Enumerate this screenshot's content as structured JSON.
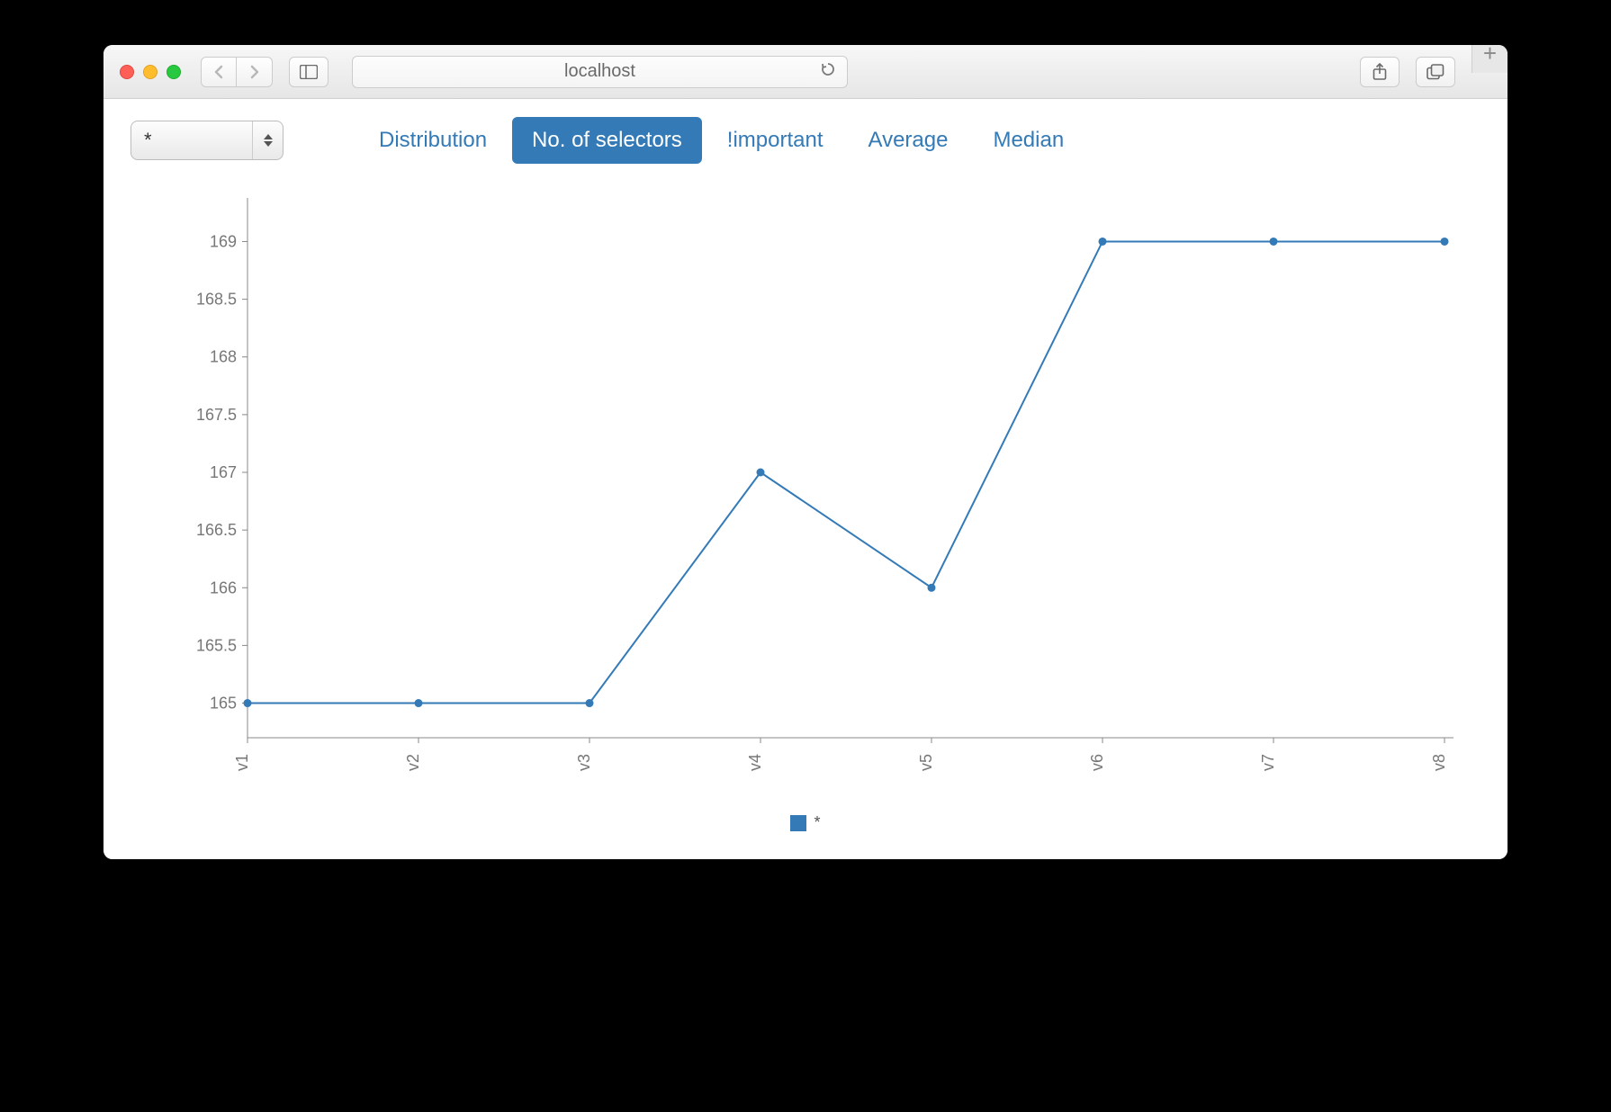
{
  "browser": {
    "address": "localhost"
  },
  "toolbar": {
    "select_value": "*",
    "tabs": [
      {
        "label": "Distribution",
        "active": false
      },
      {
        "label": "No. of selectors",
        "active": true
      },
      {
        "label": "!important",
        "active": false
      },
      {
        "label": "Average",
        "active": false
      },
      {
        "label": "Median",
        "active": false
      }
    ]
  },
  "chart_data": {
    "type": "line",
    "categories": [
      "v1",
      "v2",
      "v3",
      "v4",
      "v5",
      "v6",
      "v7",
      "v8"
    ],
    "series": [
      {
        "name": "*",
        "values": [
          165,
          165,
          165,
          167,
          166,
          169,
          169,
          169
        ]
      }
    ],
    "y_ticks": [
      165,
      165.5,
      166,
      166.5,
      167,
      167.5,
      168,
      168.5,
      169
    ],
    "ylim": [
      164.7,
      169.3
    ],
    "xlabel": "",
    "ylabel": "",
    "title": ""
  },
  "legend": {
    "label": "*"
  }
}
